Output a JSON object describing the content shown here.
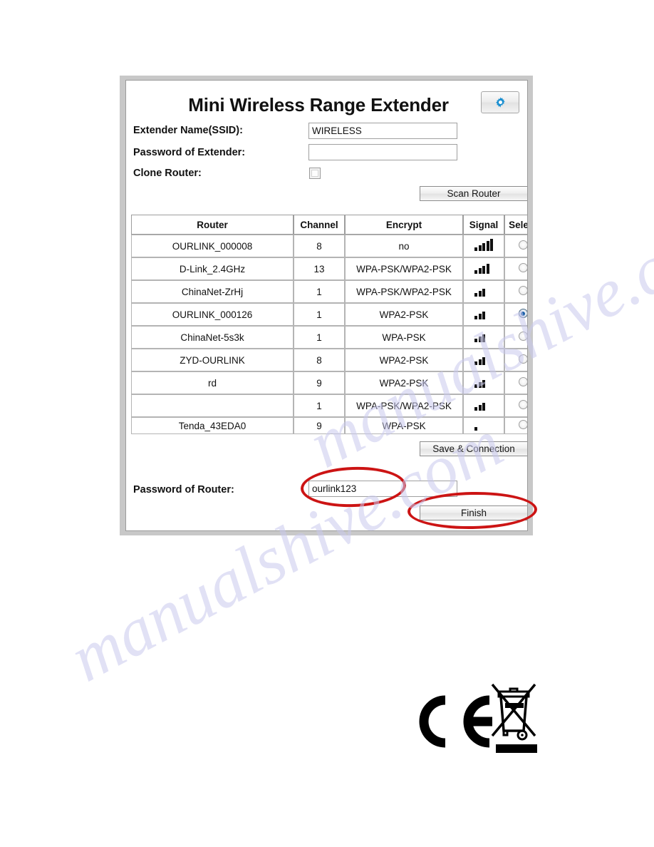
{
  "header": {
    "title": "Mini Wireless Range Extender",
    "gear_icon": "gear-icon"
  },
  "form": {
    "ssid_label": "Extender Name(SSID):",
    "ssid_value": "WIRELESS",
    "password_label": "Password of Extender:",
    "password_value": "",
    "clone_label": "Clone Router:",
    "clone_checked": false,
    "scan_button": "Scan Router"
  },
  "table": {
    "columns": [
      "Router",
      "Channel",
      "Encrypt",
      "Signal",
      "Select"
    ],
    "rows": [
      {
        "router": "OURLINK_000008",
        "channel": "8",
        "encrypt": "no",
        "signal": 5,
        "selected": false
      },
      {
        "router": "D-Link_2.4GHz",
        "channel": "13",
        "encrypt": "WPA-PSK/WPA2-PSK",
        "signal": 4,
        "selected": false
      },
      {
        "router": "ChinaNet-ZrHj",
        "channel": "1",
        "encrypt": "WPA-PSK/WPA2-PSK",
        "signal": 3,
        "selected": false
      },
      {
        "router": "OURLINK_000126",
        "channel": "1",
        "encrypt": "WPA2-PSK",
        "signal": 3,
        "selected": true
      },
      {
        "router": "ChinaNet-5s3k",
        "channel": "1",
        "encrypt": "WPA-PSK",
        "signal": 3,
        "selected": false
      },
      {
        "router": "ZYD-OURLINK",
        "channel": "8",
        "encrypt": "WPA2-PSK",
        "signal": 3,
        "selected": false
      },
      {
        "router": "rd",
        "channel": "9",
        "encrypt": "WPA2-PSK",
        "signal": 3,
        "selected": false
      },
      {
        "router": "",
        "channel": "1",
        "encrypt": "WPA-PSK/WPA2-PSK",
        "signal": 3,
        "selected": false
      },
      {
        "router": "Tenda_43EDA0",
        "channel": "9",
        "encrypt": "WPA-PSK",
        "signal": 1,
        "selected": false
      }
    ]
  },
  "footer": {
    "save_button": "Save & Connection",
    "router_password_label": "Password of Router:",
    "router_password_value": "ourlink123",
    "finish_button": "Finish"
  },
  "annotations": {
    "highlight_color": "#cc1414",
    "items": [
      "router-password-field",
      "finish-button"
    ]
  },
  "watermark": {
    "line_a": "manualshive.com",
    "line_b": "manualshive.com"
  },
  "marks": {
    "ce": "CE",
    "weee": "crossed-out-wheelie-bin"
  }
}
